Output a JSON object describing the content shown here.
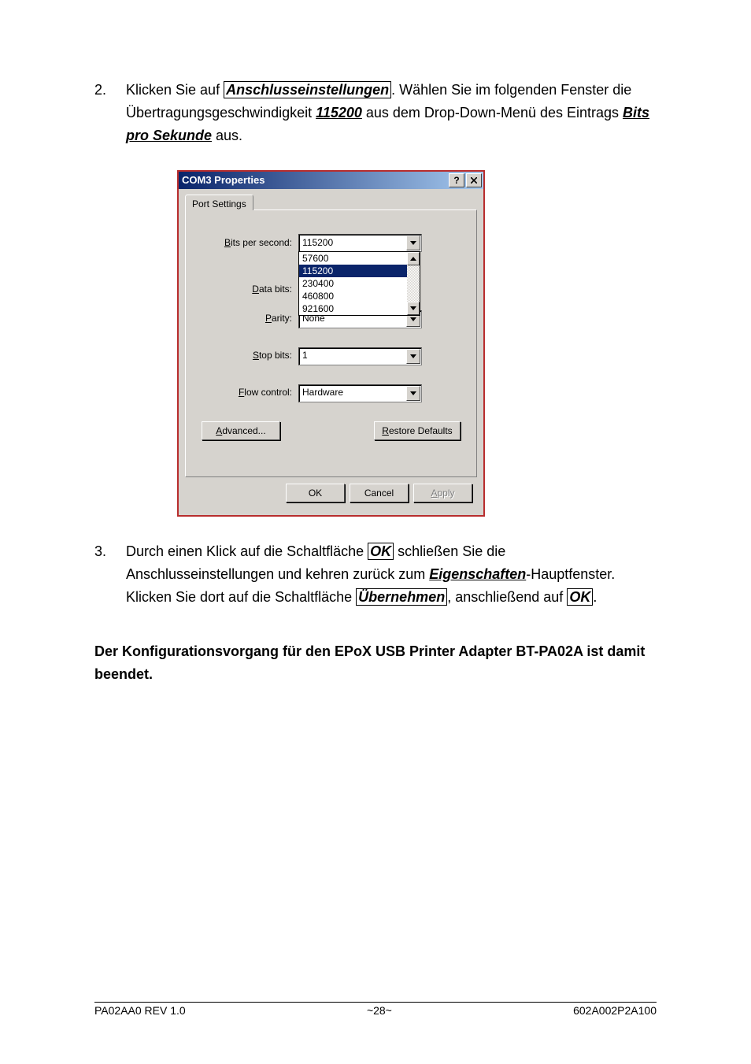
{
  "step2": {
    "num": "2.",
    "t1a": "Klicken Sie auf ",
    "btn1": "Anschlusseinstellungen",
    "t1b": ". Wählen Sie im folgenden Fenster die Übertragungsgeschwindigkeit ",
    "val": "115200",
    "t1c": " aus dem Drop-Down-Menü des Eintrags ",
    "lbl": "Bits pro Sekunde",
    "t1d": " aus."
  },
  "dialog": {
    "title": "COM3 Properties",
    "tab": "Port Settings",
    "labels": {
      "bps_pre": "B",
      "bps_u": "its per second:",
      "db_pre": "D",
      "db_u": "ata bits:",
      "par_pre": "P",
      "par_u": "arity:",
      "sb_pre": "S",
      "sb_u": "top bits:",
      "fc_pre": "F",
      "fc_u": "low control:"
    },
    "values": {
      "bps": "115200",
      "parity": "None",
      "stopbits": "1",
      "flow": "Hardware"
    },
    "dropdown": [
      "57600",
      "115200",
      "230400",
      "460800",
      "921600"
    ],
    "dropdown_selected_index": 1,
    "buttons": {
      "advanced_u": "A",
      "advanced_rest": "dvanced...",
      "restore_u": "R",
      "restore_rest": "estore Defaults",
      "ok": "OK",
      "cancel": "Cancel",
      "apply_u": "A",
      "apply_rest": "pply"
    }
  },
  "step3": {
    "num": "3.",
    "t1a": "Durch einen Klick auf die Schaltfläche ",
    "ok": "OK",
    "t1b": " schließen Sie die Anschlusseinstellungen und kehren zurück zum ",
    "eig": "Eigenschaften",
    "t1c": "-Hauptfenster. Klicken Sie dort auf die Schaltfläche ",
    "ueb": "Übernehmen",
    "t1d": ", anschließend auf ",
    "ok2": "OK",
    "t1e": "."
  },
  "finish": "Der Konfigurationsvorgang für den EPoX USB Printer Adapter BT-PA02A ist damit beendet.",
  "footer": {
    "left": "PA02AA0    REV 1.0",
    "center": "~28~",
    "right": "602A002P2A100"
  }
}
